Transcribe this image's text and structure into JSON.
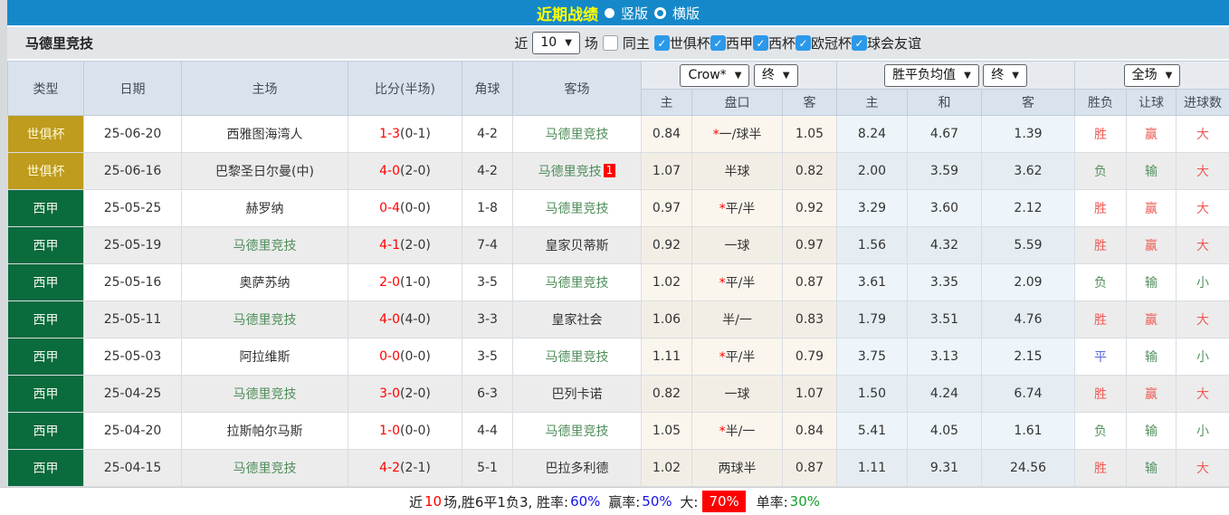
{
  "topbar": {
    "title": "近期战绩",
    "radios": [
      {
        "label": "竖版",
        "selected": true
      },
      {
        "label": "横版",
        "selected": false
      }
    ]
  },
  "filterbar": {
    "team": "马德里竞技",
    "near_label": "近",
    "matches_value": "10",
    "matches_label": "场",
    "same_home_label": "同主",
    "same_home_checked": false,
    "competitions": [
      {
        "label": "世俱杯",
        "checked": true
      },
      {
        "label": "西甲",
        "checked": true
      },
      {
        "label": "西杯",
        "checked": true
      },
      {
        "label": "欧冠杯",
        "checked": true
      },
      {
        "label": "球会友谊",
        "checked": true
      }
    ]
  },
  "table": {
    "selects": {
      "company": "Crow*",
      "company_time": "终",
      "avg": "胜平负均值",
      "avg_time": "终",
      "scope": "全场"
    },
    "headers": {
      "type": "类型",
      "date": "日期",
      "home": "主场",
      "score": "比分(半场)",
      "corners": "角球",
      "away": "客场",
      "odds_home": "主",
      "handicap": "盘口",
      "odds_away": "客",
      "avg_home": "主",
      "avg_draw": "和",
      "avg_away": "客",
      "result": "胜负",
      "handicap_result": "让球",
      "goals": "进球数"
    },
    "type_colors": {
      "世俱杯": {
        "bg": "#bf9b1e",
        "fg": "#fdf9cf"
      },
      "西甲": {
        "bg": "#0a6b3d",
        "fg": "#eef7ef"
      }
    },
    "team_color": "#4f8d5a",
    "result_colors": {
      "胜": "#f05b56",
      "负": "#55925f",
      "平": "#5566dd",
      "赢": "#f05b56",
      "输": "#55925f",
      "大": "#f05b56",
      "小": "#55925f"
    },
    "rows": [
      {
        "type": "世俱杯",
        "date": "25-06-20",
        "home": "西雅图海湾人",
        "score": "1-3",
        "half": "(0-1)",
        "corners": "4-2",
        "away": "马德里竞技",
        "away_badge": "",
        "h_home": "0.84",
        "h_star": true,
        "h_text": "一/球半",
        "h_away": "1.05",
        "avg_home": "8.24",
        "avg_draw": "4.67",
        "avg_away": "1.39",
        "result": "胜",
        "let": "赢",
        "goal": "大"
      },
      {
        "type": "世俱杯",
        "date": "25-06-16",
        "home": "巴黎圣日尔曼(中)",
        "score": "4-0",
        "half": "(2-0)",
        "corners": "4-2",
        "away": "马德里竞技",
        "away_badge": "1",
        "h_home": "1.07",
        "h_star": false,
        "h_text": "半球",
        "h_away": "0.82",
        "avg_home": "2.00",
        "avg_draw": "3.59",
        "avg_away": "3.62",
        "result": "负",
        "let": "输",
        "goal": "大"
      },
      {
        "type": "西甲",
        "date": "25-05-25",
        "home": "赫罗纳",
        "score": "0-4",
        "half": "(0-0)",
        "corners": "1-8",
        "away": "马德里竞技",
        "away_badge": "",
        "h_home": "0.97",
        "h_star": true,
        "h_text": "平/半",
        "h_away": "0.92",
        "avg_home": "3.29",
        "avg_draw": "3.60",
        "avg_away": "2.12",
        "result": "胜",
        "let": "赢",
        "goal": "大"
      },
      {
        "type": "西甲",
        "date": "25-05-19",
        "home": "马德里竞技",
        "score": "4-1",
        "half": "(2-0)",
        "corners": "7-4",
        "away": "皇家贝蒂斯",
        "away_badge": "",
        "h_home": "0.92",
        "h_star": false,
        "h_text": "一球",
        "h_away": "0.97",
        "avg_home": "1.56",
        "avg_draw": "4.32",
        "avg_away": "5.59",
        "result": "胜",
        "let": "赢",
        "goal": "大"
      },
      {
        "type": "西甲",
        "date": "25-05-16",
        "home": "奥萨苏纳",
        "score": "2-0",
        "half": "(1-0)",
        "corners": "3-5",
        "away": "马德里竞技",
        "away_badge": "",
        "h_home": "1.02",
        "h_star": true,
        "h_text": "平/半",
        "h_away": "0.87",
        "avg_home": "3.61",
        "avg_draw": "3.35",
        "avg_away": "2.09",
        "result": "负",
        "let": "输",
        "goal": "小"
      },
      {
        "type": "西甲",
        "date": "25-05-11",
        "home": "马德里竞技",
        "score": "4-0",
        "half": "(4-0)",
        "corners": "3-3",
        "away": "皇家社会",
        "away_badge": "",
        "h_home": "1.06",
        "h_star": false,
        "h_text": "半/一",
        "h_away": "0.83",
        "avg_home": "1.79",
        "avg_draw": "3.51",
        "avg_away": "4.76",
        "result": "胜",
        "let": "赢",
        "goal": "大"
      },
      {
        "type": "西甲",
        "date": "25-05-03",
        "home": "阿拉维斯",
        "score": "0-0",
        "half": "(0-0)",
        "corners": "3-5",
        "away": "马德里竞技",
        "away_badge": "",
        "h_home": "1.11",
        "h_star": true,
        "h_text": "平/半",
        "h_away": "0.79",
        "avg_home": "3.75",
        "avg_draw": "3.13",
        "avg_away": "2.15",
        "result": "平",
        "let": "输",
        "goal": "小"
      },
      {
        "type": "西甲",
        "date": "25-04-25",
        "home": "马德里竞技",
        "score": "3-0",
        "half": "(2-0)",
        "corners": "6-3",
        "away": "巴列卡诺",
        "away_badge": "",
        "h_home": "0.82",
        "h_star": false,
        "h_text": "一球",
        "h_away": "1.07",
        "avg_home": "1.50",
        "avg_draw": "4.24",
        "avg_away": "6.74",
        "result": "胜",
        "let": "赢",
        "goal": "大"
      },
      {
        "type": "西甲",
        "date": "25-04-20",
        "home": "拉斯帕尔马斯",
        "score": "1-0",
        "half": "(0-0)",
        "corners": "4-4",
        "away": "马德里竞技",
        "away_badge": "",
        "h_home": "1.05",
        "h_star": true,
        "h_text": "半/一",
        "h_away": "0.84",
        "avg_home": "5.41",
        "avg_draw": "4.05",
        "avg_away": "1.61",
        "result": "负",
        "let": "输",
        "goal": "小"
      },
      {
        "type": "西甲",
        "date": "25-04-15",
        "home": "马德里竞技",
        "score": "4-2",
        "half": "(2-1)",
        "corners": "5-1",
        "away": "巴拉多利德",
        "away_badge": "",
        "h_home": "1.02",
        "h_star": false,
        "h_text": "两球半",
        "h_away": "0.87",
        "avg_home": "1.11",
        "avg_draw": "9.31",
        "avg_away": "24.56",
        "result": "胜",
        "let": "输",
        "goal": "大"
      }
    ]
  },
  "summary": {
    "prefix": "近",
    "count": "10",
    "middle": "场,胜6平1负3, 胜率:",
    "win_rate": "60%",
    "let_label": "赢率:",
    "let_rate": "50%",
    "big_label": "大:",
    "big_rate": "70%",
    "single_label": "单率:",
    "single_rate": "30%"
  }
}
